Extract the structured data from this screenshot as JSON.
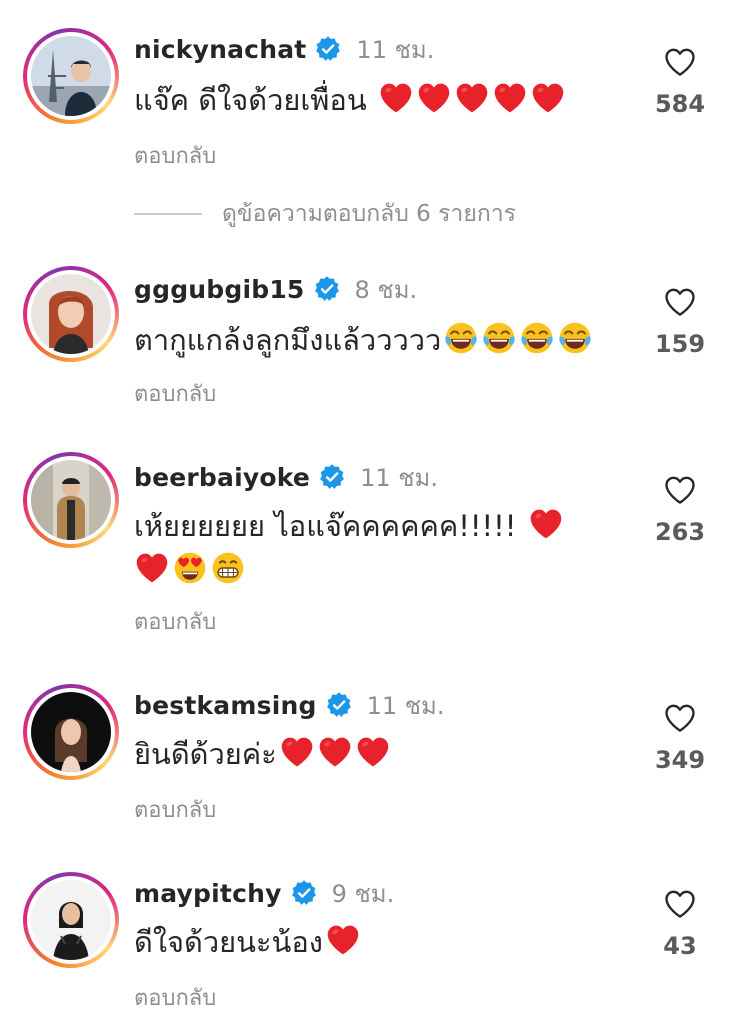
{
  "colors": {
    "verified": "#1c96e8",
    "heart_red": "#e8222b",
    "muted": "#8e8e8e",
    "text": "#262626"
  },
  "comments": [
    {
      "username": "nickynachat",
      "time": "11 ชม.",
      "text": "แจ๊ค ดีใจด้วยเพื่อน",
      "emoji_trail": [
        "red-heart-emoji",
        "red-heart-emoji",
        "red-heart-emoji",
        "red-heart-emoji",
        "red-heart-emoji"
      ],
      "reply_label": "ตอบกลับ",
      "like_count": "584"
    },
    {
      "username": "gggubgib15",
      "time": "8 ชม.",
      "text": "ตากูแกล้งลูกมึงแล้ววววว",
      "emoji_trail": [
        "tears-of-joy-emoji",
        "tears-of-joy-emoji",
        "tears-of-joy-emoji",
        "tears-of-joy-emoji"
      ],
      "reply_label": "ตอบกลับ",
      "like_count": "159"
    },
    {
      "username": "beerbaiyoke",
      "time": "11 ชม.",
      "text": "เห้ยยยยยย  ไอแจ๊คคคคคค!!!!!",
      "emoji_trail": [
        "red-heart-emoji",
        "red-heart-emoji",
        "heart-eyes-emoji",
        "grinning-emoji"
      ],
      "reply_label": "ตอบกลับ",
      "like_count": "263"
    },
    {
      "username": "bestkamsing",
      "time": "11 ชม.",
      "text": "ยินดีด้วยค่ะ",
      "emoji_trail": [
        "red-heart-emoji",
        "red-heart-emoji",
        "red-heart-emoji"
      ],
      "reply_label": "ตอบกลับ",
      "like_count": "349"
    },
    {
      "username": "maypitchy",
      "time": "9 ชม.",
      "text": "ดีใจด้วยนะน้อง",
      "emoji_trail": [
        "red-heart-emoji"
      ],
      "reply_label": "ตอบกลับ",
      "like_count": "43"
    }
  ],
  "view_replies": {
    "label": "ดูข้อความตอบกลับ 6 รายการ"
  }
}
